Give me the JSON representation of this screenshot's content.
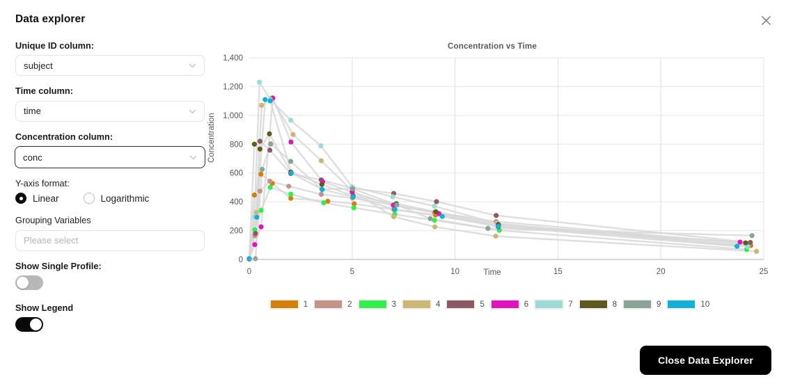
{
  "modal": {
    "title": "Data explorer",
    "close_icon": "close-x-icon",
    "close_button_label": "Close Data Explorer"
  },
  "controls": {
    "unique_id": {
      "label": "Unique ID column:",
      "value": "subject",
      "chevron_icon": "chevron-down-icon"
    },
    "time_column": {
      "label": "Time column:",
      "value": "time",
      "chevron_icon": "chevron-down-icon"
    },
    "conc_column": {
      "label": "Concentration column:",
      "value": "conc",
      "chevron_icon": "chevron-down-icon",
      "focused": true
    },
    "y_axis_format": {
      "label": "Y-axis format:",
      "options": [
        {
          "label": "Linear",
          "selected": true
        },
        {
          "label": "Logarithmic",
          "selected": false
        }
      ]
    },
    "grouping_variables": {
      "label": "Grouping Variables",
      "value": "",
      "placeholder": "Please select"
    },
    "show_single_profile": {
      "label": "Show Single Profile:",
      "on": false
    },
    "show_legend": {
      "label": "Show Legend",
      "on": true
    }
  },
  "chart_data": {
    "type": "line",
    "title": "Concentration vs Time",
    "xlabel": "Time",
    "ylabel": "Concentration",
    "xlim": [
      0,
      25
    ],
    "ylim": [
      0,
      1400
    ],
    "xticks": [
      0,
      5,
      10,
      15,
      20,
      25
    ],
    "xtick_labels": [
      "0",
      "5",
      "10",
      "15",
      "20",
      "25"
    ],
    "yticks": [
      0,
      200,
      400,
      600,
      800,
      1000,
      1200,
      1400
    ],
    "ytick_labels": [
      "0",
      "200",
      "400",
      "600",
      "800",
      "1,000",
      "1,200",
      "1,400"
    ],
    "grid": true,
    "legend_position": "bottom",
    "markers": true,
    "line_color": "#d8d8d8",
    "series": [
      {
        "name": "1",
        "color": "#d2800a",
        "x": [
          0.0,
          0.25,
          0.57,
          1.12,
          2.02,
          3.82,
          5.1,
          7.03,
          9.05,
          12.12,
          24.37
        ],
        "y": [
          4,
          447,
          592,
          528,
          424,
          404,
          386,
          346,
          308,
          239,
          96
        ]
      },
      {
        "name": "2",
        "color": "#c39288",
        "x": [
          0.0,
          0.27,
          0.52,
          1.0,
          1.92,
          3.5,
          5.02,
          7.03,
          9.0,
          12.0,
          24.3
        ],
        "y": [
          3,
          164,
          474,
          543,
          508,
          452,
          426,
          377,
          327,
          263,
          108
        ]
      },
      {
        "name": "3",
        "color": "#34ec4e",
        "x": [
          0.0,
          0.27,
          0.58,
          1.02,
          2.02,
          3.62,
          5.08,
          7.07,
          9.0,
          12.15,
          24.17
        ],
        "y": [
          4,
          206,
          341,
          500,
          453,
          393,
          358,
          313,
          272,
          202,
          69
        ]
      },
      {
        "name": "4",
        "color": "#cbb675",
        "x": [
          0.0,
          0.35,
          0.6,
          1.07,
          2.13,
          3.5,
          5.02,
          7.02,
          9.02,
          11.98,
          24.65
        ],
        "y": [
          4,
          327,
          1070,
          1120,
          867,
          685,
          474,
          296,
          226,
          161,
          56
        ]
      },
      {
        "name": "5",
        "color": "#8c5a64",
        "x": [
          0.0,
          0.3,
          0.52,
          1.0,
          2.02,
          3.5,
          5.02,
          7.02,
          9.1,
          12.0,
          24.35
        ],
        "y": [
          6,
          180,
          820,
          758,
          596,
          552,
          494,
          458,
          401,
          305,
          118
        ]
      },
      {
        "name": "6",
        "color": "#dd16bd",
        "x": [
          0.0,
          0.27,
          0.58,
          1.15,
          2.03,
          3.57,
          5.0,
          7.0,
          9.22,
          12.1,
          23.85
        ],
        "y": [
          4,
          103,
          226,
          1120,
          815,
          539,
          468,
          376,
          318,
          226,
          120
        ]
      },
      {
        "name": "7",
        "color": "#9bdbd4",
        "x": [
          0.0,
          0.25,
          0.5,
          1.02,
          2.02,
          3.48,
          5.0,
          6.98,
          9.0,
          12.05,
          24.22
        ],
        "y": [
          2,
          297,
          1230,
          1110,
          966,
          789,
          505,
          435,
          370,
          249,
          89
        ]
      },
      {
        "name": "8",
        "color": "#60591e",
        "x": [
          0.0,
          0.25,
          0.52,
          0.98,
          2.02,
          3.53,
          5.05,
          7.15,
          9.07,
          12.1,
          24.12
        ],
        "y": [
          3,
          800,
          766,
          872,
          607,
          521,
          441,
          387,
          331,
          243,
          115
        ]
      },
      {
        "name": "9",
        "color": "#89a396",
        "x": [
          0.0,
          0.3,
          0.63,
          1.05,
          2.02,
          3.53,
          5.02,
          7.17,
          8.8,
          11.6,
          24.43
        ],
        "y": [
          6,
          5,
          625,
          802,
          680,
          487,
          491,
          378,
          283,
          216,
          165
        ]
      },
      {
        "name": "10",
        "color": "#11b0d4",
        "x": [
          0.0,
          0.37,
          0.77,
          1.02,
          2.05,
          3.55,
          5.05,
          7.08,
          9.38,
          12.1,
          23.7
        ],
        "y": [
          3,
          293,
          1110,
          1100,
          600,
          485,
          435,
          346,
          298,
          229,
          91
        ]
      }
    ]
  },
  "legend": [
    {
      "label": "1",
      "color": "#d2800a"
    },
    {
      "label": "2",
      "color": "#c39288"
    },
    {
      "label": "3",
      "color": "#34ec4e"
    },
    {
      "label": "4",
      "color": "#cbb675"
    },
    {
      "label": "5",
      "color": "#8c5a64"
    },
    {
      "label": "6",
      "color": "#dd16bd"
    },
    {
      "label": "7",
      "color": "#9bdbd4"
    },
    {
      "label": "8",
      "color": "#60591e"
    },
    {
      "label": "9",
      "color": "#89a396"
    },
    {
      "label": "10",
      "color": "#11b0d4"
    }
  ]
}
